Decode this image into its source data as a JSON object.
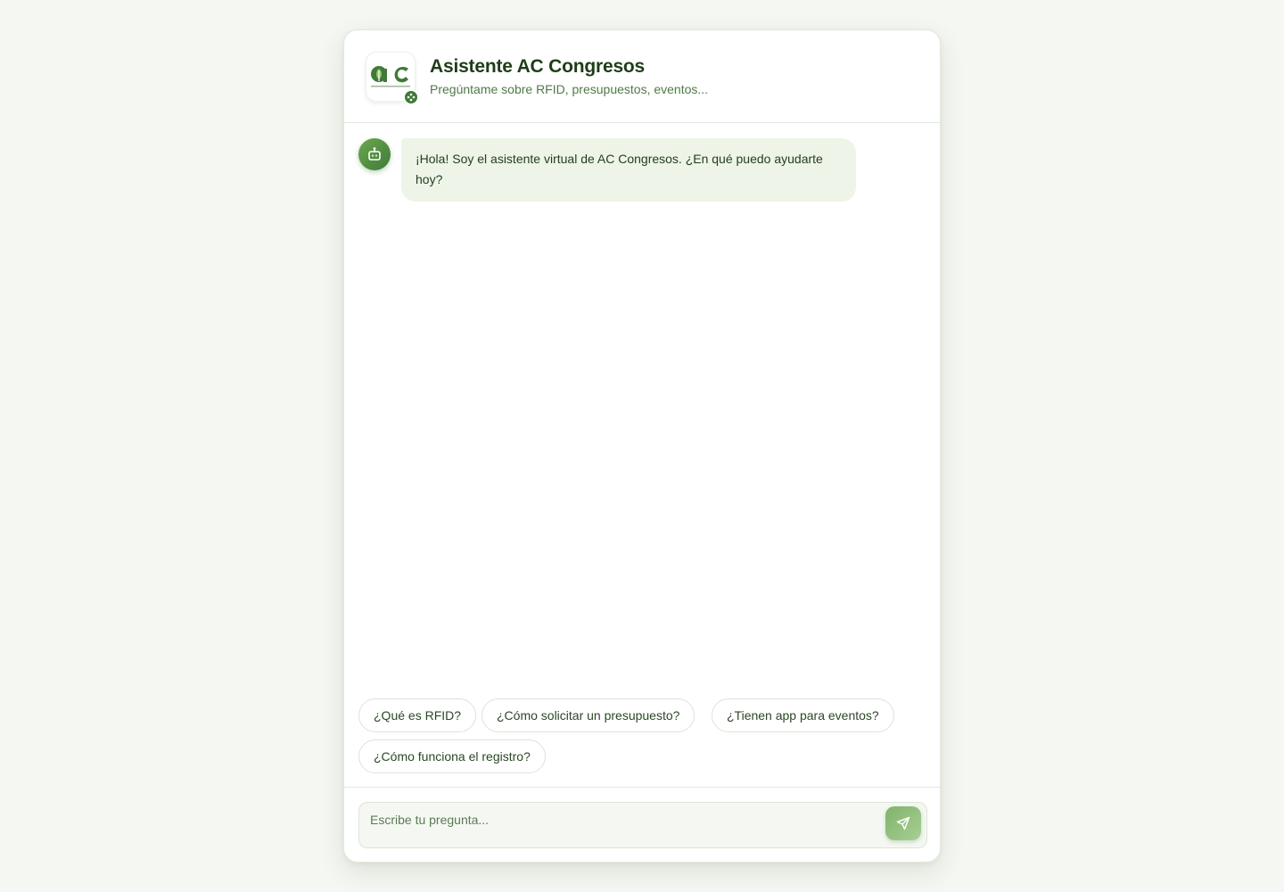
{
  "colors": {
    "brand_dark": "#1f3d18",
    "brand_green": "#3f7a36",
    "accent_light": "#eef4e8",
    "page_background": "#f5f7f2"
  },
  "header": {
    "logo_icon": "ac-congresos-logo",
    "logo_text": "aC",
    "badge_icon": "sparkle-icon",
    "title": "Asistente AC Congresos",
    "subtitle": "Pregúntame sobre RFID, presupuestos, eventos..."
  },
  "messages": [
    {
      "sender": "bot",
      "avatar_icon": "robot-icon",
      "text": "¡Hola! Soy el asistente virtual de AC Congresos. ¿En qué puedo ayudarte hoy?"
    }
  ],
  "suggestions": [
    {
      "label": "¿Qué es RFID?"
    },
    {
      "label": "¿Cómo solicitar un presupuesto?"
    },
    {
      "label": "¿Tienen app para eventos?"
    },
    {
      "label": "¿Cómo funciona el registro?"
    }
  ],
  "composer": {
    "placeholder": "Escribe tu pregunta...",
    "value": "",
    "send_icon": "send-icon"
  }
}
